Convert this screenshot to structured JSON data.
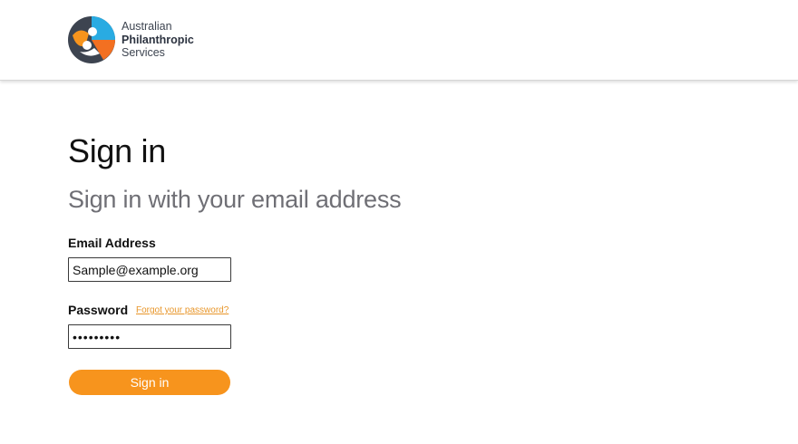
{
  "brand": {
    "line1": "Australian",
    "line2": "Philanthropic",
    "line3": "Services",
    "colors": {
      "orange": "#f7941d",
      "blue": "#29abe2",
      "slate": "#3d4450"
    }
  },
  "form": {
    "title": "Sign in",
    "subtitle": "Sign in with your email address",
    "email_label": "Email Address",
    "email_value": "Sample@example.org",
    "password_label": "Password",
    "forgot_link": "Forgot your password?",
    "password_value": "•••••••••",
    "submit_label": "Sign in"
  }
}
